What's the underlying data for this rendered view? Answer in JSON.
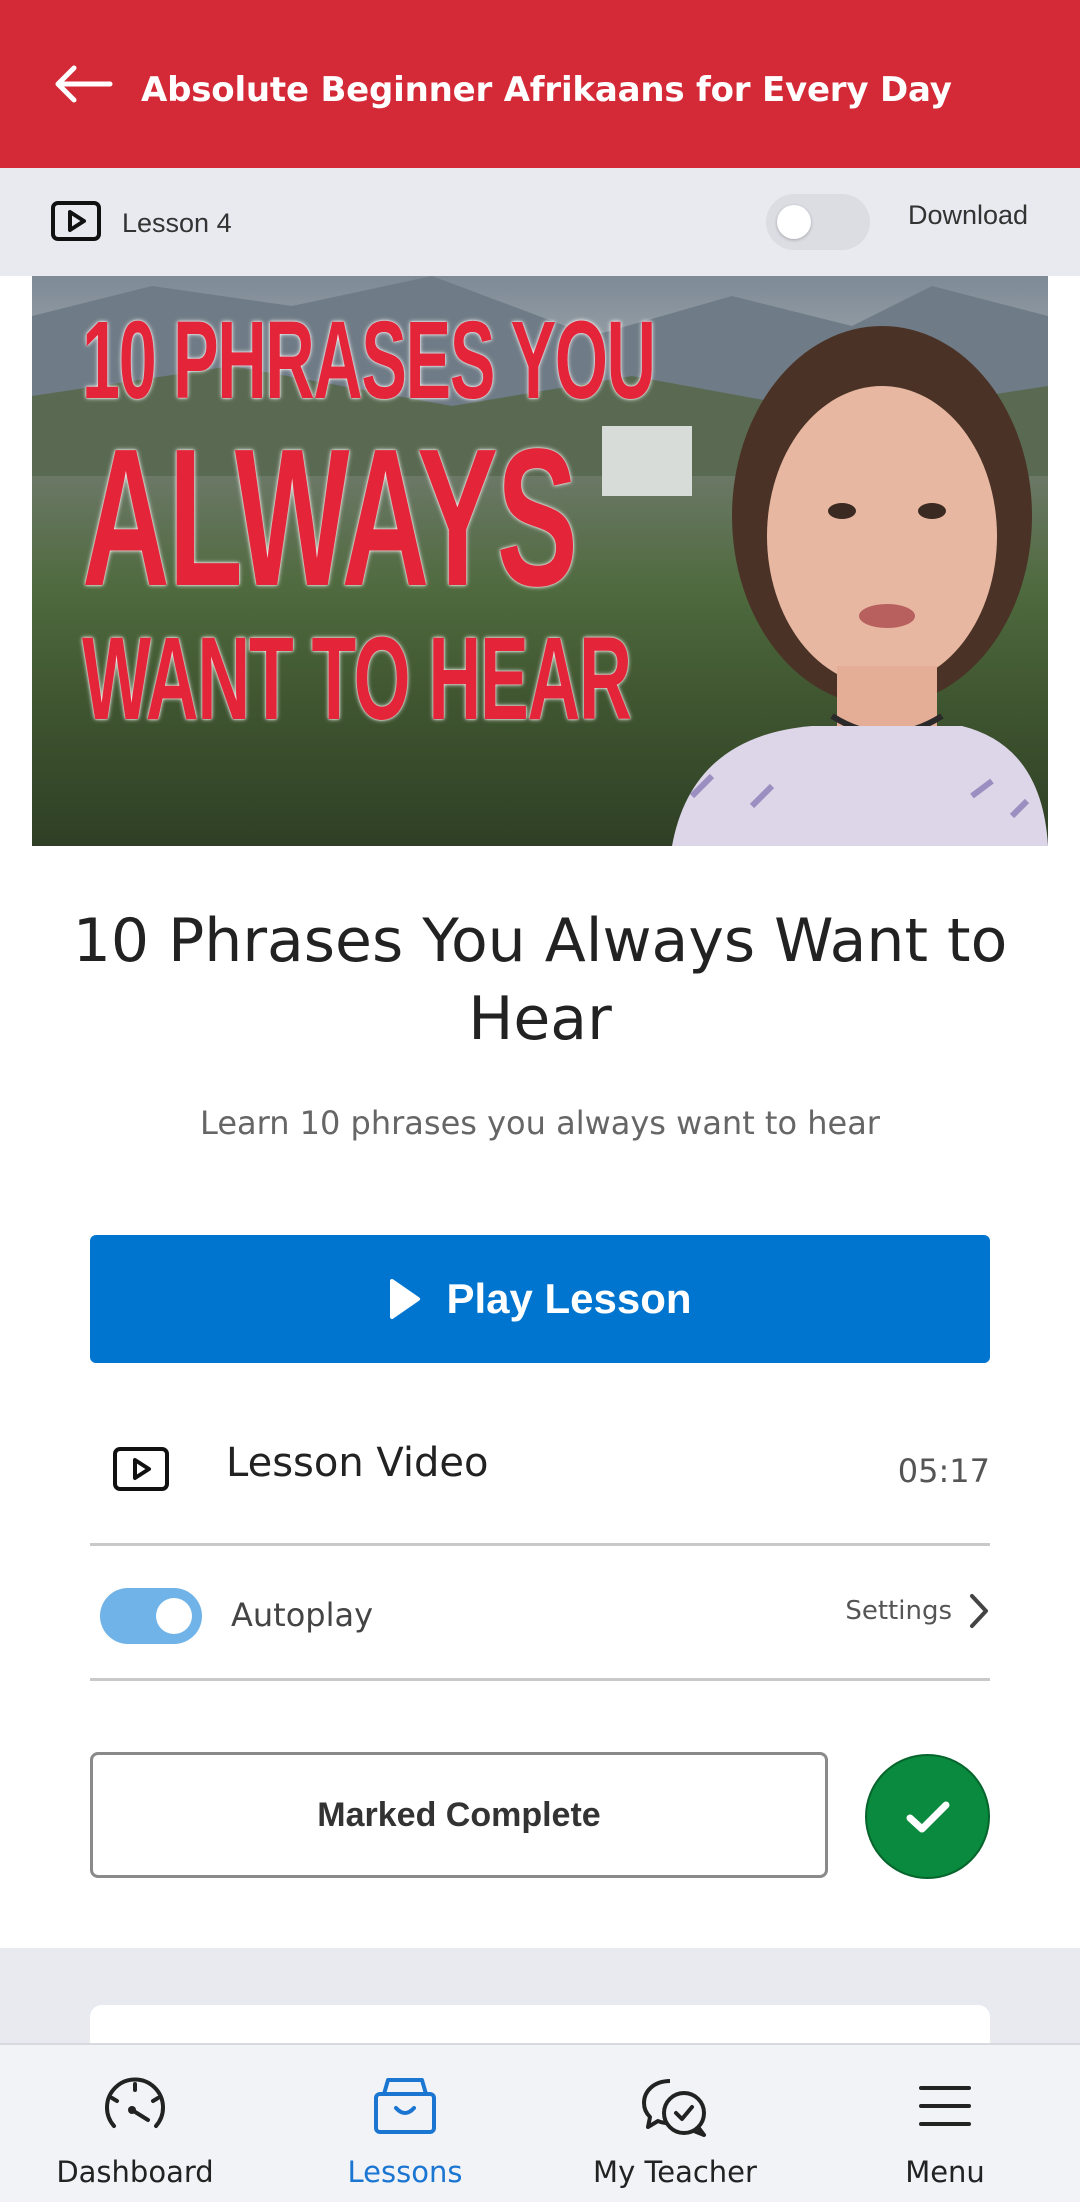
{
  "header": {
    "title": "Absolute Beginner Afrikaans for Every Day"
  },
  "sub_bar": {
    "lesson_label": "Lesson 4",
    "download_label": "Download",
    "download_enabled": false
  },
  "thumbnail": {
    "line1": "10 PHRASES YOU",
    "line2": "ALWAYS",
    "line3": "WANT TO HEAR"
  },
  "lesson": {
    "title": "10 Phrases You Always Want to Hear",
    "description": "Learn 10 phrases you always want to hear",
    "play_label": "Play Lesson"
  },
  "video": {
    "label": "Lesson Video",
    "duration": "05:17"
  },
  "autoplay": {
    "label": "Autoplay",
    "enabled": true,
    "settings_label": "Settings"
  },
  "complete": {
    "label": "Marked Complete"
  },
  "nav": {
    "items": [
      {
        "label": "Dashboard",
        "icon": "dashboard-gauge-icon"
      },
      {
        "label": "Lessons",
        "icon": "lessons-box-icon",
        "active": true
      },
      {
        "label": "My Teacher",
        "icon": "chat-bubbles-icon"
      },
      {
        "label": "Menu",
        "icon": "hamburger-menu-icon"
      }
    ]
  },
  "colors": {
    "header": "#d42a37",
    "primary": "#0075d0",
    "success": "#0a8a3e",
    "toggle_on": "#6fb3e8",
    "nav_active": "#1b76d2"
  }
}
